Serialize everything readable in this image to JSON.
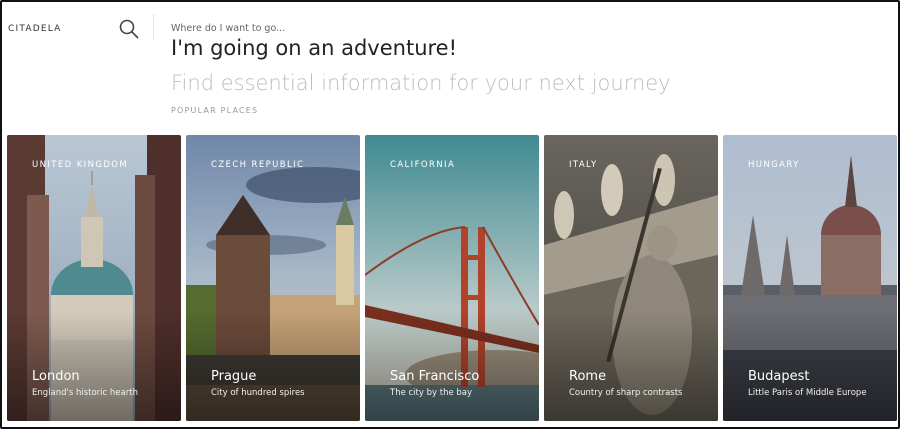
{
  "header": {
    "logo": "CITADELA",
    "search_icon": "search-icon",
    "hint": "Where do I want to go...",
    "headline": "I'm going on an adventure!",
    "subline": "Find essential information for your next journey",
    "section_label": "POPULAR PLACES"
  },
  "places": [
    {
      "country": "UNITED KINGDOM",
      "city": "London",
      "description": "England's historic hearth"
    },
    {
      "country": "CZECH REPUBLIC",
      "city": "Prague",
      "description": "City of hundred spires"
    },
    {
      "country": "CALIFORNIA",
      "city": "San Francisco",
      "description": "The city by the bay"
    },
    {
      "country": "ITALY",
      "city": "Rome",
      "description": "Country of sharp contrasts"
    },
    {
      "country": "HUNGARY",
      "city": "Budapest",
      "description": "Little Paris of Middle Europe"
    }
  ],
  "colors": {
    "headline": "#222222",
    "subline": "#bdbdbd",
    "muted": "#999999"
  }
}
